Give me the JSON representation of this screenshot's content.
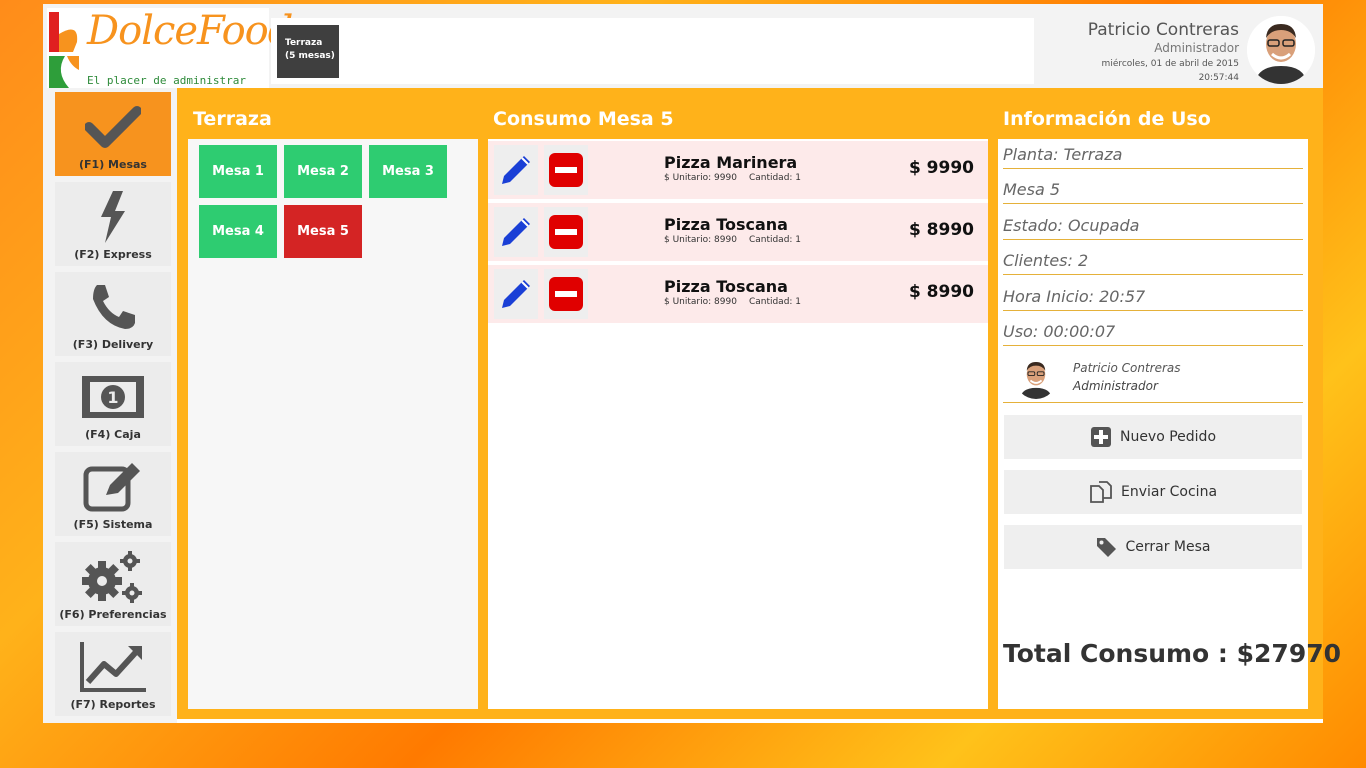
{
  "header": {
    "logo_text": "DolceFood",
    "logo_tagline": "El placer de administrar",
    "floor_chip": {
      "name": "Terraza",
      "count": "(5 mesas)"
    },
    "user": {
      "name": "Patricio Contreras",
      "role": "Administrador",
      "date": "miércoles, 01 de abril de 2015",
      "time": "20:57:44"
    }
  },
  "sidebar": {
    "items": [
      {
        "label": "(F1) Mesas",
        "icon": "check-icon",
        "active": true
      },
      {
        "label": "(F2) Express",
        "icon": "lightning-icon",
        "active": false
      },
      {
        "label": "(F3) Delivery",
        "icon": "phone-icon",
        "active": false
      },
      {
        "label": "(F4) Caja",
        "icon": "cash-icon",
        "active": false
      },
      {
        "label": "(F5) Sistema",
        "icon": "edit-icon",
        "active": false
      },
      {
        "label": "(F6) Preferencias",
        "icon": "gears-icon",
        "active": false
      },
      {
        "label": "(F7) Reportes",
        "icon": "chart-icon",
        "active": false
      }
    ]
  },
  "floor_panel": {
    "title": "Terraza",
    "tables": [
      {
        "label": "Mesa 1",
        "status_color": "#2ecc71"
      },
      {
        "label": "Mesa 2",
        "status_color": "#2ecc71"
      },
      {
        "label": "Mesa 3",
        "status_color": "#2ecc71"
      },
      {
        "label": "Mesa 4",
        "status_color": "#2ecc71"
      },
      {
        "label": "Mesa 5",
        "status_color": "#d42424"
      }
    ]
  },
  "order_panel": {
    "title": "Consumo Mesa 5",
    "items": [
      {
        "name": "Pizza Marinera",
        "unit": "$ Unitario: 9990",
        "qty": "Cantidad: 1",
        "price": "$ 9990"
      },
      {
        "name": "Pizza Toscana",
        "unit": "$ Unitario: 8990",
        "qty": "Cantidad: 1",
        "price": "$ 8990"
      },
      {
        "name": "Pizza Toscana",
        "unit": "$ Unitario: 8990",
        "qty": "Cantidad: 1",
        "price": "$ 8990"
      }
    ]
  },
  "info_panel": {
    "title": "Información de Uso",
    "planta": "Planta: Terraza",
    "mesa": "Mesa 5",
    "estado": "Estado: Ocupada",
    "clientes": "Clientes: 2",
    "hora_inicio": "Hora Inicio: 20:57",
    "uso": "Uso: 00:00:07",
    "attender": {
      "name": "Patricio Contreras",
      "role": "Administrador"
    },
    "actions": {
      "nuevo_pedido": "Nuevo Pedido",
      "enviar_cocina": "Enviar Cocina",
      "cerrar_mesa": "Cerrar Mesa"
    },
    "total": "Total Consumo : $27970"
  },
  "colors": {
    "accent": "#f7931e",
    "panel_bg": "#ffb21a",
    "table_free": "#2ecc71",
    "table_busy": "#d42424"
  }
}
